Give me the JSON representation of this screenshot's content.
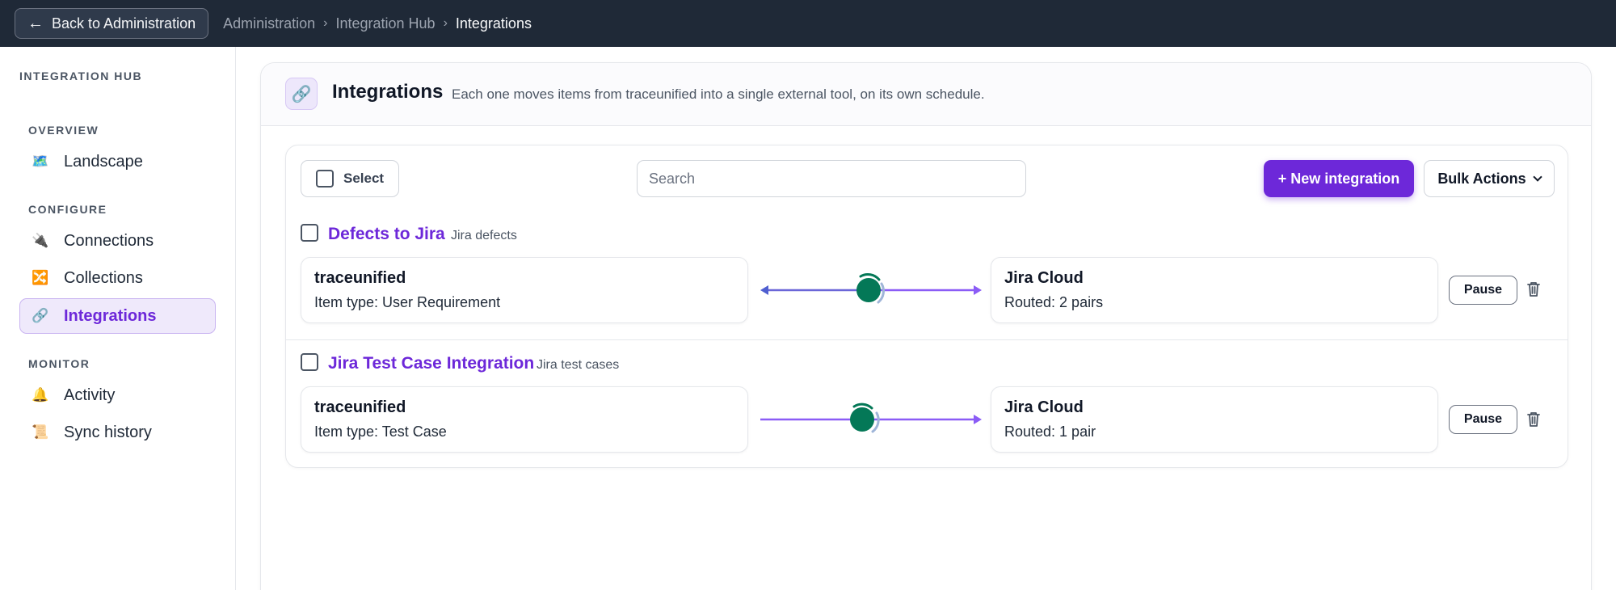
{
  "topbar": {
    "back_label": "Back to Administration",
    "back_icon": "left-arrow-icon",
    "breadcrumb": [
      "Administration",
      "Integration Hub",
      "Integrations"
    ]
  },
  "sidebar": {
    "title": "INTEGRATION HUB",
    "sections": [
      {
        "label": "OVERVIEW",
        "items": [
          {
            "label": "Landscape",
            "icon": "map-icon"
          }
        ]
      },
      {
        "label": "CONFIGURE",
        "items": [
          {
            "label": "Connections",
            "icon": "plug-icon"
          },
          {
            "label": "Collections",
            "icon": "shuffle-icon"
          },
          {
            "label": "Integrations",
            "icon": "link-icon",
            "active": true
          }
        ]
      },
      {
        "label": "MONITOR",
        "items": [
          {
            "label": "Activity",
            "icon": "bell-icon"
          },
          {
            "label": "Sync history",
            "icon": "scroll-icon"
          }
        ]
      }
    ]
  },
  "panel": {
    "title": "Integrations",
    "subtitle": "Each one moves items from traceunified into a single external tool, on its own schedule.",
    "icon": "link-icon"
  },
  "toolbar": {
    "select_label": "Select",
    "search_placeholder": "Search",
    "new_label": "+ New integration",
    "bulk_label": "Bulk Actions"
  },
  "integrations": [
    {
      "name": "Defects to Jira",
      "tag": "Jira defects",
      "source": {
        "title": "traceunified",
        "subtitle": "Item type: User Requirement"
      },
      "target": {
        "title": "Jira Cloud",
        "subtitle": "Routed: 2 pairs"
      },
      "direction": "bidirectional",
      "pause_label": "Pause"
    },
    {
      "name": "Jira Test Case Integration",
      "tag": "Jira test cases",
      "source": {
        "title": "traceunified",
        "subtitle": "Item type: Test Case"
      },
      "target": {
        "title": "Jira Cloud",
        "subtitle": "Routed: 1 pair"
      },
      "direction": "one-way",
      "pause_label": "Pause"
    }
  ],
  "colors": {
    "accent": "#6d28d9",
    "topbar": "#1f2937",
    "status": "#047857",
    "flow_left": "#4f5fd0",
    "flow_right": "#8b5cf6"
  }
}
